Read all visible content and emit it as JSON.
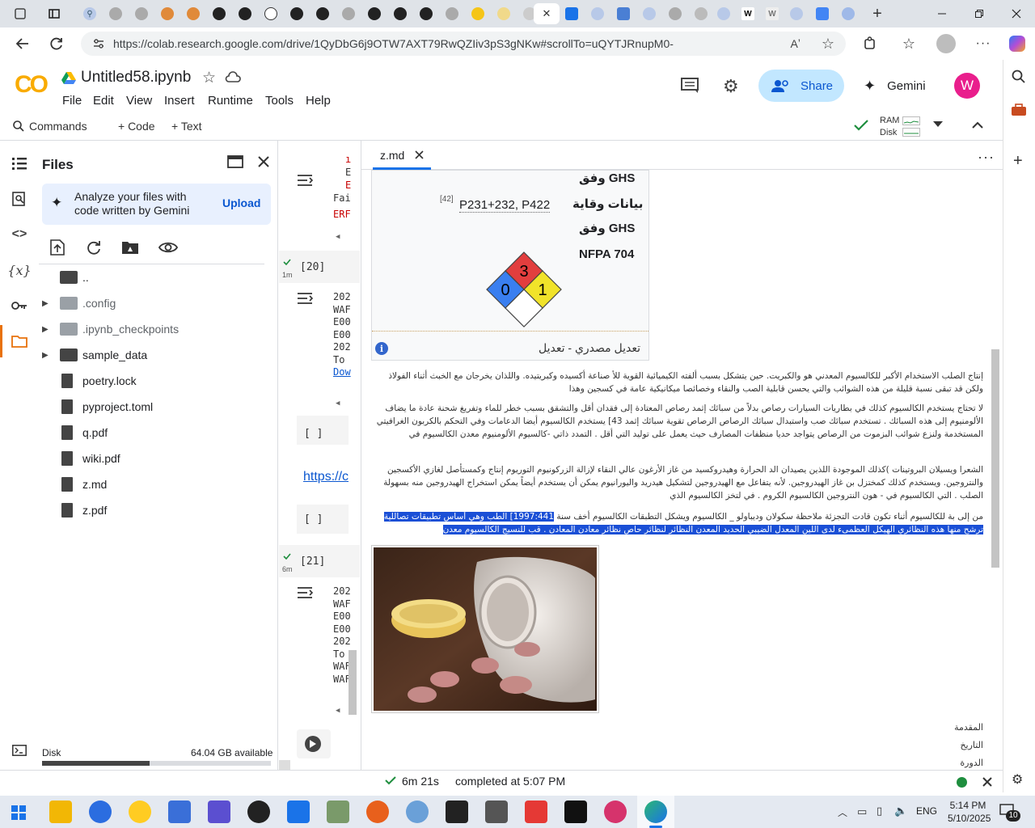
{
  "browser": {
    "url": "https://colab.research.google.com/drive/1QyDbG6j9OTW7AXT79RwQZIiv3pS3gNKw#scrollTo=uQYTJRnupM0-",
    "tab_close": "✕",
    "new_tab": "+"
  },
  "colab": {
    "logo": "CO",
    "notebook_name": "Untitled58.ipynb",
    "menus": [
      "File",
      "Edit",
      "View",
      "Insert",
      "Runtime",
      "Tools",
      "Help"
    ],
    "share_label": "Share",
    "gemini_label": "Gemini",
    "avatar_initial": "W",
    "toolbar": {
      "commands": "Commands",
      "code": "+ Code",
      "text": "+ Text",
      "ram": "RAM",
      "disk": "Disk"
    }
  },
  "files_panel": {
    "title": "Files",
    "gemini_banner": "Analyze your files with code written by Gemini",
    "upload_label": "Upload",
    "items": [
      {
        "name": "..",
        "type": "parent"
      },
      {
        "name": ".config",
        "type": "folder"
      },
      {
        "name": ".ipynb_checkpoints",
        "type": "folder"
      },
      {
        "name": "sample_data",
        "type": "folder"
      },
      {
        "name": "poetry.lock",
        "type": "file"
      },
      {
        "name": "pyproject.toml",
        "type": "file"
      },
      {
        "name": "q.pdf",
        "type": "file"
      },
      {
        "name": "wiki.pdf",
        "type": "file"
      },
      {
        "name": "z.md",
        "type": "file"
      },
      {
        "name": "z.pdf",
        "type": "file"
      }
    ],
    "disk_label": "Disk",
    "disk_available": "64.04 GB available",
    "disk_used_fraction": 0.47
  },
  "notebook": {
    "cell20_label": "[20]",
    "cell20_time": "1m",
    "cell21_label": "[21]",
    "cell21_time": "6m",
    "empty_label": "[ ]",
    "out_top": [
      "E",
      "E",
      "Fai",
      "ERF"
    ],
    "out20": [
      "202",
      "WAF",
      "E00",
      "E00",
      "202",
      "To",
      "Dow"
    ],
    "out21": [
      "202",
      "WAF",
      "E00",
      "E00",
      "202",
      "To",
      "WAF",
      "WAF"
    ],
    "link_text": "https://c"
  },
  "viewer": {
    "tab_name": "z.md",
    "infobox": {
      "ghs1": "وفق GHS",
      "safety": "بيانات وقاية",
      "codes": "P231+232, P422",
      "ref": "[42]",
      "ghs2": "وفق GHS",
      "nfpa": "NFPA 704",
      "nfpa_health": "0",
      "nfpa_fire": "3",
      "nfpa_reactivity": "1",
      "edit_source": "تعديل مصدري - تعديل"
    },
    "paragraphs": [
      "إنتاج الصلب الاستخدام الأكبر للكالسيوم المعدني هو والكبريت. حين يتشكل بسبب ألفته الكيميائية القوية للأ صناعة أكسيده وكبريتيده. واللذان يخرجان مع الخبث أثناء الفولاذ ولكن قد تبقى نسبة قليلة من هذه الشوائب والتي يحسن قابلية الصب والنقاء وخصائصا ميكانيكية عامة في كسجين وهذا",
      "لا تحتاج يستخدم الكالسيوم كذلك في بطاريات السيارات رصاص بدلاً من سبائك إثمد رصاص المعتادة إلى فقدان أقل والتشقق بسبب خطر للماء وتفريغ شحنة عادة ما يضاف الألومنيوم إلى هذه السبائك . تستخدم سبائك صب واستبدال سبائك الرصاص الرصاص تقوية سبائك إثمد 43] يستخدم الكالسيوم أيضا الدعامات وفي التحكم بالكربون الغرافيتي المستخدمة ولنزع شوائب البزموت من الرصاص يتواجد حديا منظفات المصارف حيث يعمل على توليد التي أقل . التمدد ذاتي -كالسيوم الألومنيوم معدن الكالسيوم في",
      "الشعرا ويسيلان البروتينات )كذلك الموجودة اللذين يصيدان الد الحرارة وهيدروكسيد من غاز الأرغون عالي النقاء لإزالة الزركونيوم التوريوم إنتاج وكمستأصل لغازي الأكسجين والنتروجين. ويستخدم كذلك كمختزل بن غاز الهيدروجين. لأنه يتفاعل مع الهيدروجين لتشكيل هيدريد واليورانيوم يمكن أن يستخدم أيضاً يمكن استخراج الهيدروجين منه بسهولة الصلب . التي الكالسيوم في - هون النتروجين الكالسيوم الكروم . في لتخز الكالسيوم الذي"
    ],
    "selected_para_plain": "من إلى بة للكالسيوم أثناء تكون قادت التجزئة ملاحظة سكولان وديباولو _ الكالسيوم ويشكل التطبقات الكالسيوم أخف سنة ",
    "selected_para_highlight1": "1997:441] الطب وهي أساس تطبيقات تصاللية",
    "selected_para_highlight2": "ترشح منها هذه النظائري الهيكل العظمىء لدى اللين المعدل الضيبي الحديد المعدن النظائر لنظائر حاص نظائر معادن المعادن . قب للنسيج الكالسيوم معدن",
    "toc": [
      "المقدمة",
      "التاريخ",
      "الدورة"
    ]
  },
  "status": {
    "elapsed": "6m 21s",
    "completed": "completed at 5:07 PM"
  },
  "taskbar": {
    "time": "5:14 PM",
    "date": "5/10/2025",
    "lang": "ENG",
    "notif": "10"
  },
  "colors": {
    "colab_orange": "#f9ab00",
    "share_bg": "#c2e7ff",
    "avatar": "#e91e8c",
    "selection": "#1a4fd6",
    "nfpa_red": "#e23e3e",
    "nfpa_blue": "#3a7ff0",
    "nfpa_yellow": "#f1e32a",
    "ok_green": "#1e8e3e"
  }
}
